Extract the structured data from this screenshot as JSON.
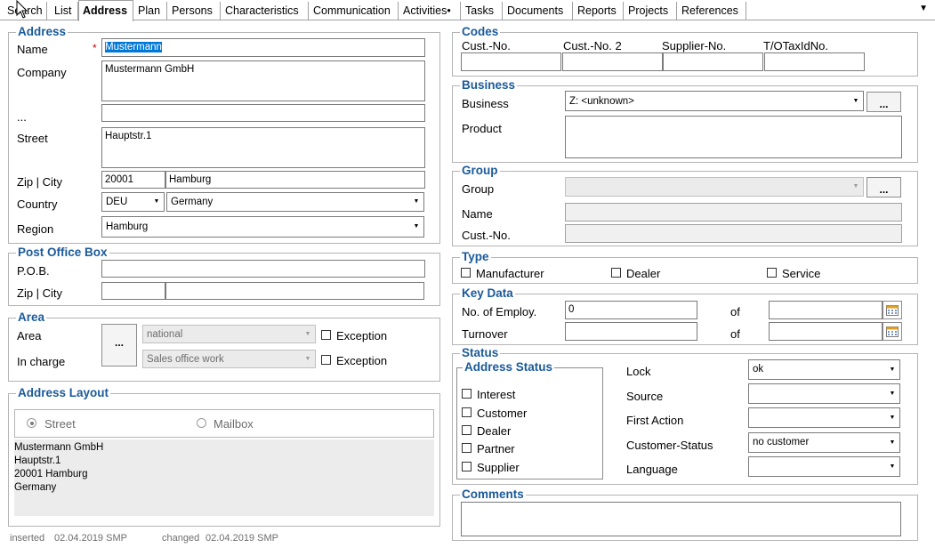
{
  "tabs": [
    "Search",
    "List",
    "Address",
    "Plan",
    "Persons",
    "Characteristics",
    "Communication",
    "Activities•",
    "Tasks",
    "Documents",
    "Reports",
    "Projects",
    "References"
  ],
  "address": {
    "title": "Address",
    "name_label": "Name",
    "required_mark": "*",
    "name_value": "Mustermann",
    "company_label": "Company",
    "company_value": "Mustermann GmbH",
    "extra_label": "...",
    "extra_value": "",
    "street_label": "Street",
    "street_value": "Hauptstr.1",
    "zip_city_label": "Zip | City",
    "zip_value": "20001",
    "city_value": "Hamburg",
    "country_label": "Country",
    "country_code": "DEU",
    "country_name": "Germany",
    "region_label": "Region",
    "region_value": "Hamburg"
  },
  "pobox": {
    "title": "Post Office Box",
    "pob_label": "P.O.B.",
    "zip_city_label": "Zip | City"
  },
  "area": {
    "title": "Area",
    "area_label": "Area",
    "area_value": "national",
    "incharge_label": "In charge",
    "incharge_value": "Sales office work",
    "exception_label": "Exception",
    "dots": "..."
  },
  "layout": {
    "title": "Address Layout",
    "street_label": "Street",
    "mailbox_label": "Mailbox",
    "preview": "Mustermann GmbH\nHauptstr.1\n20001 Hamburg\nGermany"
  },
  "footer": {
    "inserted_label": "inserted",
    "inserted_value": "02.04.2019 SMP",
    "changed_label": "changed",
    "changed_value": "02.04.2019 SMP"
  },
  "codes": {
    "title": "Codes",
    "cols": [
      "Cust.-No.",
      "Cust.-No. 2",
      "Supplier-No.",
      "T/OTaxIdNo."
    ]
  },
  "business": {
    "title": "Business",
    "business_label": "Business",
    "business_value": "Z: <unknown>",
    "product_label": "Product",
    "dots": "..."
  },
  "group": {
    "title": "Group",
    "group_label": "Group",
    "name_label": "Name",
    "custno_label": "Cust.-No.",
    "dots": "..."
  },
  "type": {
    "title": "Type",
    "options": [
      "Manufacturer",
      "Dealer",
      "Service"
    ]
  },
  "keydata": {
    "title": "Key Data",
    "employ_label": "No. of Employ.",
    "employ_value": "0",
    "turnover_label": "Turnover",
    "of_label": "of"
  },
  "status": {
    "title": "Status",
    "addr_status_title": "Address Status",
    "addr_status_options": [
      "Interest",
      "Customer",
      "Dealer",
      "Partner",
      "Supplier"
    ],
    "lock_label": "Lock",
    "lock_value": "ok",
    "source_label": "Source",
    "first_action_label": "First Action",
    "customer_status_label": "Customer-Status",
    "customer_status_value": "no customer",
    "language_label": "Language"
  },
  "comments": {
    "title": "Comments"
  },
  "colors": {
    "group_title": "#1a5a9a",
    "selection": "#0078d7"
  }
}
